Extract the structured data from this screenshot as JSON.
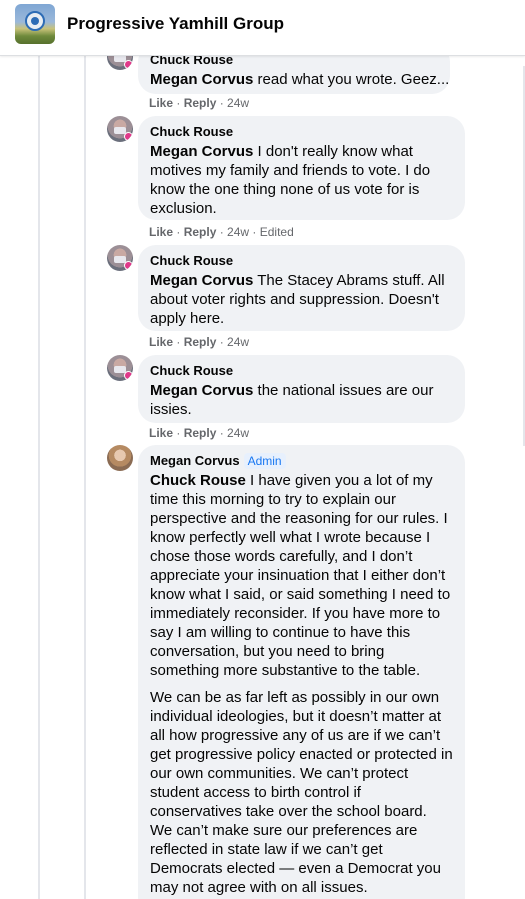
{
  "header": {
    "group_name": "Progressive Yamhill Group"
  },
  "comments": [
    {
      "author": "Chuck Rouse",
      "mention": "Megan Corvus",
      "text": " read what you wrote. Geez...",
      "like": "Like",
      "reply": "Reply",
      "time": "24w",
      "edited": ""
    },
    {
      "author": "Chuck Rouse",
      "mention": "Megan Corvus",
      "text": " I don't really know what motives my family and friends to vote. I do know the one thing none of us vote for is exclusion.",
      "like": "Like",
      "reply": "Reply",
      "time": "24w",
      "edited": "Edited"
    },
    {
      "author": "Chuck Rouse",
      "mention": "Megan Corvus",
      "text": " The Stacey Abrams stuff. All about voter rights and suppression. Doesn't apply here.",
      "like": "Like",
      "reply": "Reply",
      "time": "24w",
      "edited": ""
    },
    {
      "author": "Chuck Rouse",
      "mention": "Megan Corvus",
      "text": " the national issues are our issies.",
      "like": "Like",
      "reply": "Reply",
      "time": "24w",
      "edited": ""
    },
    {
      "author": "Megan Corvus",
      "badge": "Admin",
      "mention": "Chuck Rouse",
      "text": " I have given you a lot of my time this morning to try to explain our perspective and the reasoning for our rules. I know perfectly well what I wrote because I chose those words carefully, and I don’t appreciate your insinuation that I either don’t know what I said, or said something I need to immediately reconsider. If you have more to say I am willing to continue to have this conversation, but you need to bring something more substantive to the table.",
      "text2": "We can be as far left as possibly in our own individual ideologies, but it doesn’t matter at all how progressive any of us are if we can’t get progressive policy enacted or protected in our own communities. We can’t protect student access to birth control if conservatives take over the school board. We can’t make sure our preferences are reflected in state law if we can’t get Democrats elected — even a Democrat you may not agree with on all issues."
    }
  ]
}
